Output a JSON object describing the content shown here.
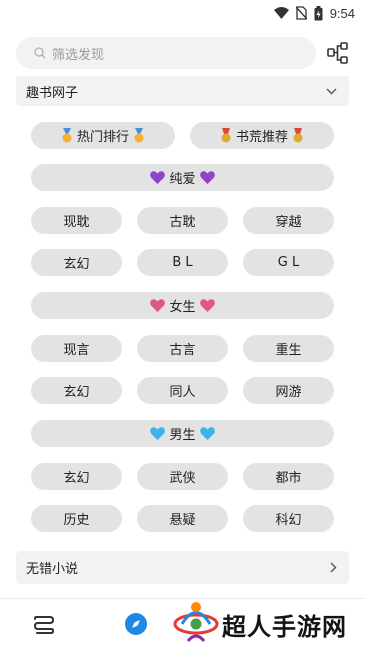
{
  "status_bar": {
    "time": "9:54"
  },
  "search": {
    "placeholder": "筛选发现"
  },
  "section_top": {
    "title": "趣书网子"
  },
  "rows": {
    "hot_rank": "热门排行",
    "book_recommend": "书荒推荐",
    "category_danmei": "纯爱",
    "danmei": [
      "现耽",
      "古耽",
      "穿越",
      "玄幻",
      "B L",
      "G L"
    ],
    "category_female": "女生",
    "female": [
      "现言",
      "古言",
      "重生",
      "玄幻",
      "同人",
      "网游"
    ],
    "category_male": "男生",
    "male": [
      "玄幻",
      "武侠",
      "都市",
      "历史",
      "悬疑",
      "科幻"
    ]
  },
  "section_bottom": {
    "title": "无错小说"
  },
  "watermark": {
    "text": "超人手游网"
  },
  "colors": {
    "purple_heart": "#8e44c9",
    "pink_heart": "#e0578a",
    "blue_heart": "#3db4e6",
    "compass": "#1e88e5"
  }
}
